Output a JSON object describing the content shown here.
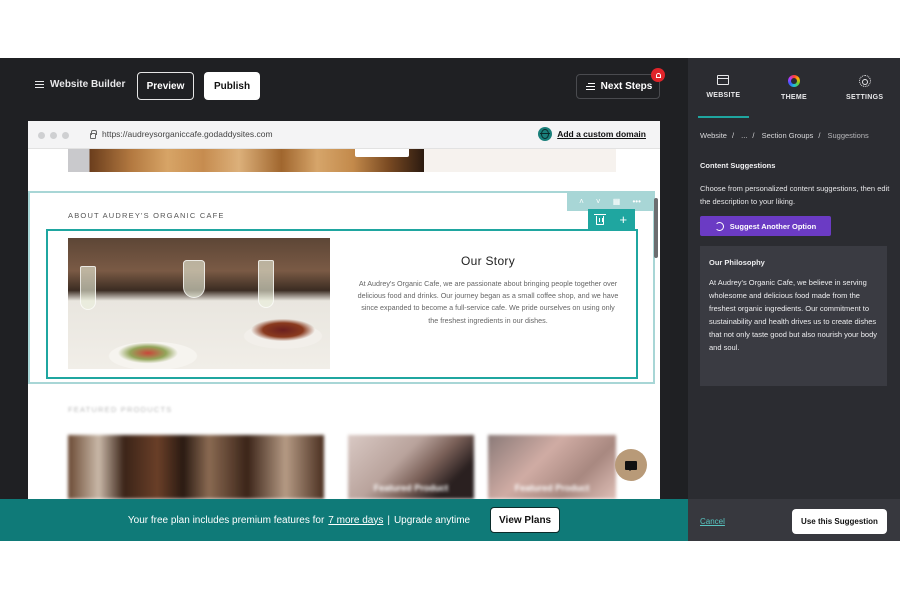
{
  "topbar": {
    "app_title": "Website Builder",
    "preview_label": "Preview",
    "publish_label": "Publish",
    "next_steps_label": "Next Steps",
    "notification_icon": "bell-icon"
  },
  "browser": {
    "url": "https://audreysorganiccafe.godaddysites.com",
    "custom_domain_label": "Add a custom domain"
  },
  "site": {
    "about_section_title": "ABOUT AUDREY'S ORGANIC CAFE",
    "story_heading": "Our Story",
    "story_body": "At Audrey's Organic Cafe, we are passionate about bringing people together over delicious food and drinks. Our journey began as a small coffee shop, and we have since expanded to become a full-service cafe. We pride ourselves on using only the freshest ingredients in our dishes.",
    "featured_title": "FEATURED PRODUCTS",
    "products": [
      {
        "label": ""
      },
      {
        "label": "Featured Product"
      },
      {
        "label": "Featured Product"
      }
    ]
  },
  "banner": {
    "text_before": "Your free plan includes premium features for",
    "link_text": "7 more days",
    "divider": "|",
    "text_after": "Upgrade anytime",
    "view_plans_label": "View Plans"
  },
  "panel": {
    "tabs": [
      {
        "label": "WEBSITE",
        "icon": "browser-window-icon",
        "active": true
      },
      {
        "label": "THEME",
        "icon": "color-wheel-icon",
        "active": false
      },
      {
        "label": "SETTINGS",
        "icon": "gear-icon",
        "active": false
      }
    ],
    "breadcrumb": [
      "Website",
      "...",
      "Section Groups",
      "Suggestions"
    ],
    "section_title": "Content Suggestions",
    "description": "Choose from personalized content suggestions, then edit the description to your liking.",
    "suggest_button": "Suggest Another Option",
    "suggestion": {
      "title": "Our Philosophy",
      "body": "At Audrey's Organic Cafe, we believe in serving wholesome and delicious food made from the freshest organic ingredients. Our commitment to sustainability and health drives us to create dishes that not only taste good but also nourish your body and soul."
    },
    "cancel_label": "Cancel",
    "use_label": "Use this Suggestion"
  },
  "colors": {
    "accent_teal": "#1fa6a0",
    "banner_teal": "#0f7a78",
    "suggest_purple": "#6b3bc4",
    "notification_red": "#e0242a"
  }
}
